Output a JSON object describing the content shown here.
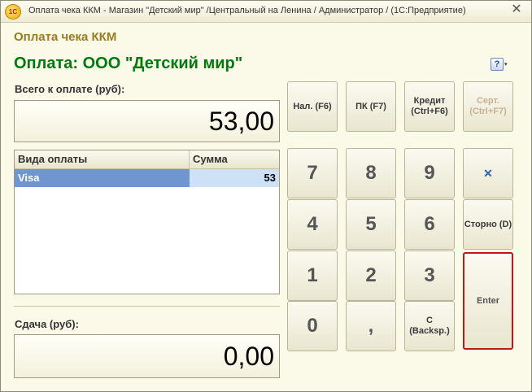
{
  "titlebar": {
    "logo": "1С",
    "title": "Оплата чека ККМ - Магазин \"Детский мир\" /Центральный на Ленина / Администратор /  (1С:Предприятие)",
    "close_glyph": "✕"
  },
  "form": {
    "title": "Оплата чека ККМ",
    "payee": "Оплата: ООО \"Детский мир\"",
    "help_glyph": "?",
    "help_arrow": "▾"
  },
  "total": {
    "label": "Всего к оплате (руб):",
    "value": "53,00"
  },
  "payments_table": {
    "headers": [
      "Вида оплаты",
      "Сумма"
    ],
    "rows": [
      {
        "method": "Visa",
        "sum": "53"
      }
    ]
  },
  "change": {
    "label": "Сдача (руб):",
    "value": "0,00"
  },
  "keypad": {
    "cash": "Нал. (F6)",
    "card": "ПК (F7)",
    "credit": "Кредит (Ctrl+F6)",
    "certificate": "Серт. (Ctrl+F7)",
    "d7": "7",
    "d8": "8",
    "d9": "9",
    "clear_glyph": "✕",
    "d4": "4",
    "d5": "5",
    "d6": "6",
    "storno": "Сторно (D)",
    "d1": "1",
    "d2": "2",
    "d3": "3",
    "enter": "Enter",
    "d0": "0",
    "comma": ",",
    "backspace": "C (Backsp.)"
  },
  "colors": {
    "form_title": "#9c7b1a",
    "payee_title": "#007a0f",
    "selected_row": "#6f96cf",
    "selected_cell": "#cfe1f7",
    "enter_border": "#c01818"
  }
}
